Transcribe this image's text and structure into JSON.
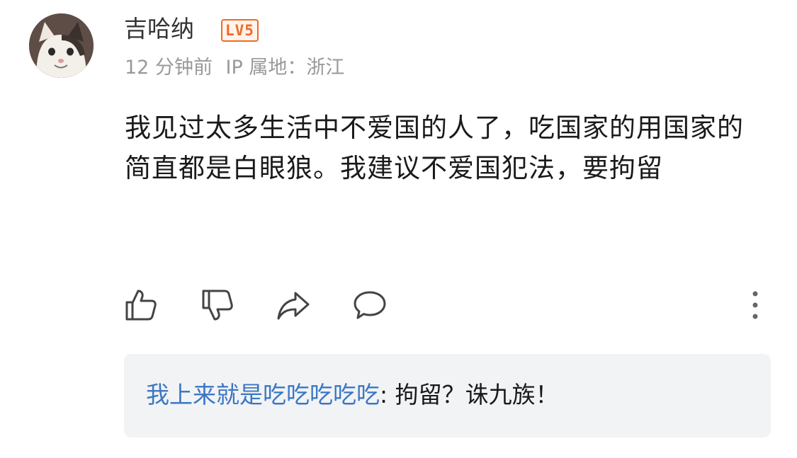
{
  "post": {
    "author": "吉哈纳",
    "level_badge": "LV5",
    "time": "12 分钟前",
    "ip_location": "IP 属地：浙江",
    "content": "我见过太多生活中不爱国的人了，吃国家的用国家的简直都是白眼狼。我建议不爱国犯法，要拘留"
  },
  "actions": {
    "icons": [
      "thumbs-up-icon",
      "thumbs-down-icon",
      "share-icon",
      "comment-icon",
      "more-icon"
    ]
  },
  "reply": {
    "author": "我上来就是吃吃吃吃吃",
    "separator": ":",
    "text": " 拘留？诛九族！"
  },
  "colors": {
    "badge": "#f06a24",
    "reply_author": "#3b77c4",
    "reply_bg": "#f2f3f5",
    "meta": "#999999"
  }
}
